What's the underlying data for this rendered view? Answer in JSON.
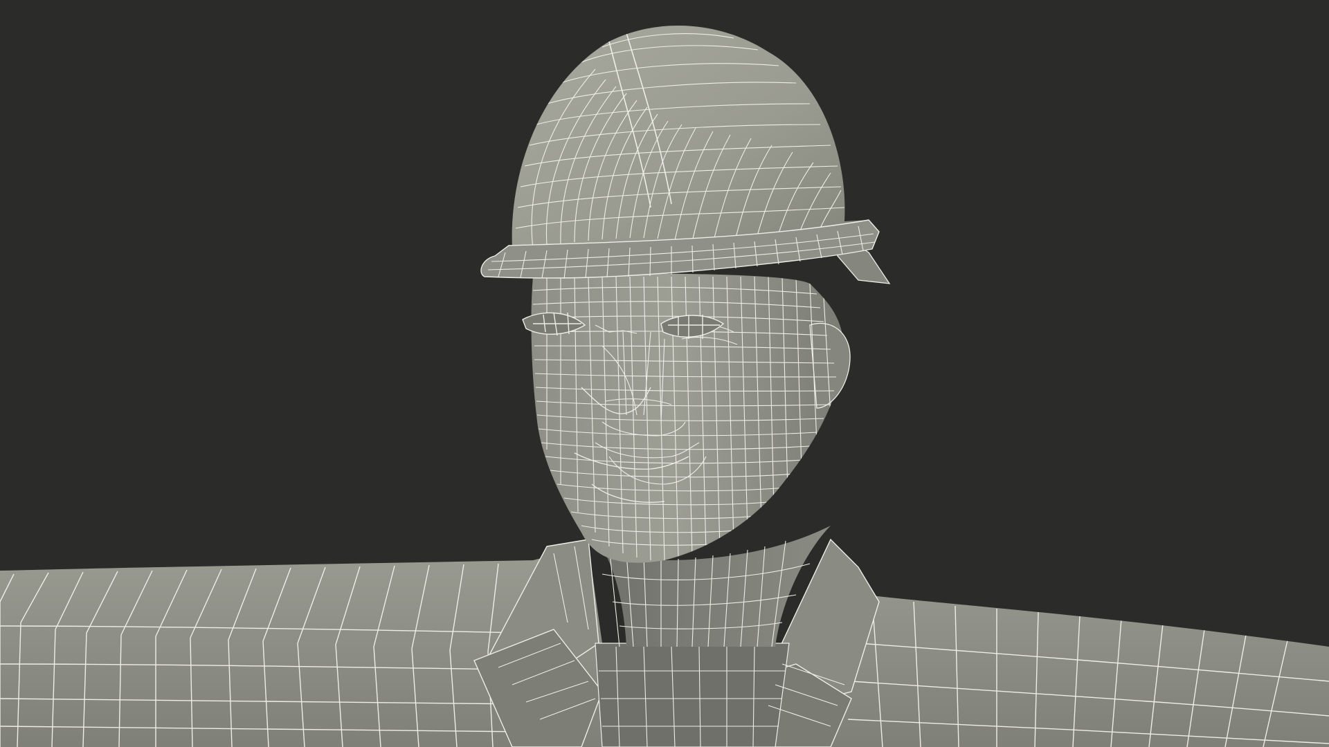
{
  "scene": {
    "subject": "wireframe-render",
    "colors": {
      "background": "#2b2b29",
      "surface_light": "#a6a79c",
      "surface_mid": "#8d8e84",
      "surface_dark": "#6d6e66",
      "wire": "#eeeee6"
    }
  }
}
